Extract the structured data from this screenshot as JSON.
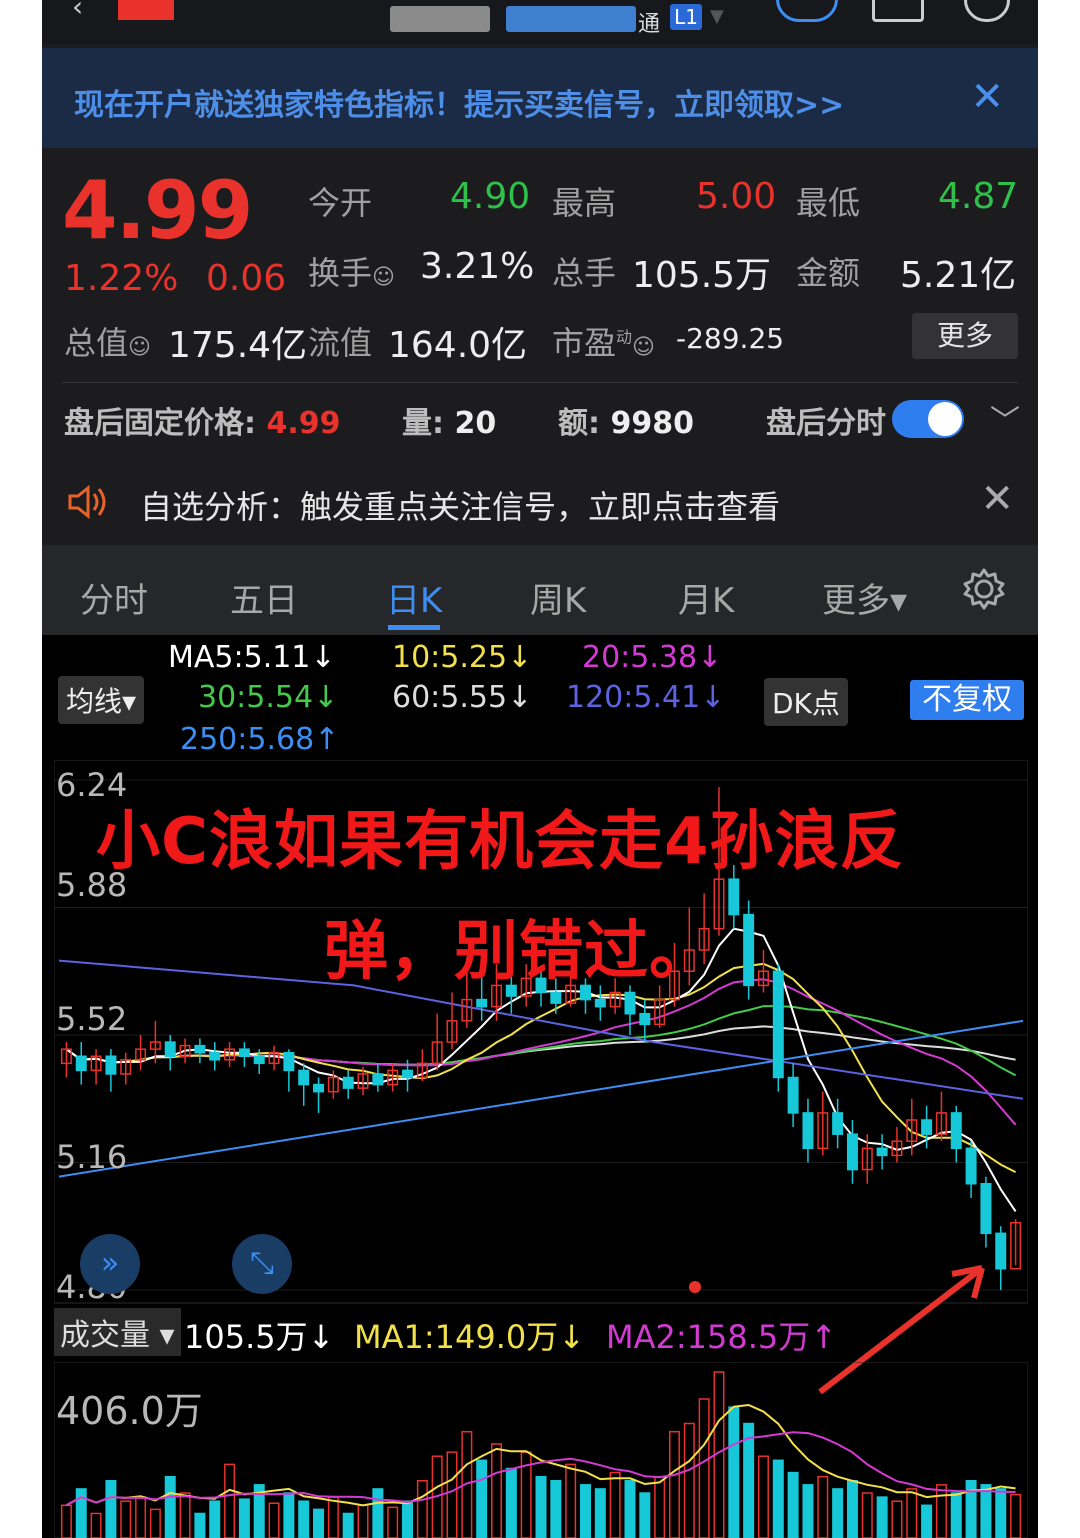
{
  "header": {
    "tag_tong": "通",
    "tag_level": "L1"
  },
  "banner": {
    "text": "现在开户就送独家特色指标！提示买卖信号，立即领取>>",
    "close": "✕"
  },
  "quote": {
    "price": "4.99",
    "change_pct": "1.22%",
    "change_abs": "0.06",
    "open_label": "今开",
    "open": "4.90",
    "high_label": "最高",
    "high": "5.00",
    "low_label": "最低",
    "low": "4.87",
    "turnover_label": "换手",
    "turnover": "3.21%",
    "volume_label": "总手",
    "volume": "105.5万",
    "amount_label": "金额",
    "amount": "5.21亿",
    "mcap_label": "总值",
    "mcap": "175.4亿",
    "float_label": "流值",
    "float": "164.0亿",
    "pe_label": "市盈",
    "pe_sup": "动",
    "pe": "-289.25",
    "more": "更多"
  },
  "after_hours": {
    "price_label": "盘后固定价格: ",
    "price": "4.99",
    "vol_label": "量: ",
    "vol": "20",
    "amt_label": "额: ",
    "amt": "9980",
    "toggle_label": "盘后分时",
    "toggle_on": true
  },
  "notice": {
    "text": "自选分析：触发重点关注信号，立即点击查看",
    "close": "✕"
  },
  "tabs": [
    {
      "label": "分时"
    },
    {
      "label": "五日"
    },
    {
      "label": "日K",
      "active": true
    },
    {
      "label": "周K"
    },
    {
      "label": "月K"
    },
    {
      "label": "更多▾"
    }
  ],
  "ma_lines": {
    "selector": "均线▾",
    "ma5": "MA5:5.11↓",
    "ma10": "10:5.25↓",
    "ma20": "20:5.38↓",
    "ma30": "30:5.54↓",
    "ma60": "60:5.55↓",
    "ma120": "120:5.41↓",
    "ma250": "250:5.68↑",
    "dk": "DK点",
    "adj": "不复权"
  },
  "colors": {
    "up": "#e8322b",
    "down": "#16c8d8",
    "accent": "#3d8ef2",
    "ma5": "#ffffff",
    "ma10": "#f2e04a",
    "ma20": "#d33ad3",
    "ma30": "#45c94a",
    "ma60": "#dcdcdc",
    "ma120": "#5c62e0",
    "ma250": "#3d8ef2"
  },
  "overlay_text": {
    "line1": "小C浪如果有机会走4孙浪反",
    "line2": "弹，别错过。"
  },
  "volume": {
    "selector": "成交量 ▾",
    "value": "105.5万↓",
    "ma1": "MA1:149.0万↓",
    "ma2": "MA2:158.5万↑",
    "max_label": "406.0万"
  },
  "chart_data": {
    "type": "candlestick",
    "y_ticks": [
      "6.24",
      "5.88",
      "5.52",
      "5.16",
      "4.80"
    ],
    "ylim": [
      4.8,
      6.24
    ],
    "candles": [
      [
        5.44,
        5.48,
        5.4,
        5.5
      ],
      [
        5.46,
        5.42,
        5.38,
        5.5
      ],
      [
        5.42,
        5.46,
        5.38,
        5.48
      ],
      [
        5.46,
        5.41,
        5.36,
        5.48
      ],
      [
        5.41,
        5.45,
        5.38,
        5.47
      ],
      [
        5.45,
        5.48,
        5.42,
        5.52
      ],
      [
        5.48,
        5.5,
        5.44,
        5.56
      ],
      [
        5.5,
        5.46,
        5.42,
        5.52
      ],
      [
        5.46,
        5.49,
        5.44,
        5.51
      ],
      [
        5.49,
        5.47,
        5.44,
        5.51
      ],
      [
        5.47,
        5.45,
        5.42,
        5.5
      ],
      [
        5.45,
        5.48,
        5.43,
        5.5
      ],
      [
        5.48,
        5.46,
        5.43,
        5.5
      ],
      [
        5.46,
        5.44,
        5.41,
        5.48
      ],
      [
        5.44,
        5.47,
        5.42,
        5.49
      ],
      [
        5.47,
        5.42,
        5.36,
        5.48
      ],
      [
        5.42,
        5.38,
        5.32,
        5.44
      ],
      [
        5.38,
        5.36,
        5.3,
        5.4
      ],
      [
        5.36,
        5.4,
        5.34,
        5.42
      ],
      [
        5.4,
        5.37,
        5.34,
        5.42
      ],
      [
        5.37,
        5.41,
        5.35,
        5.43
      ],
      [
        5.41,
        5.38,
        5.36,
        5.44
      ],
      [
        5.38,
        5.42,
        5.36,
        5.44
      ],
      [
        5.42,
        5.4,
        5.36,
        5.45
      ],
      [
        5.4,
        5.44,
        5.39,
        5.48
      ],
      [
        5.44,
        5.5,
        5.42,
        5.58
      ],
      [
        5.5,
        5.56,
        5.48,
        5.64
      ],
      [
        5.56,
        5.62,
        5.54,
        5.74
      ],
      [
        5.62,
        5.6,
        5.56,
        5.7
      ],
      [
        5.6,
        5.66,
        5.56,
        5.72
      ],
      [
        5.66,
        5.63,
        5.58,
        5.7
      ],
      [
        5.63,
        5.68,
        5.6,
        5.72
      ],
      [
        5.68,
        5.64,
        5.6,
        5.7
      ],
      [
        5.64,
        5.61,
        5.58,
        5.68
      ],
      [
        5.61,
        5.66,
        5.6,
        5.7
      ],
      [
        5.66,
        5.62,
        5.58,
        5.68
      ],
      [
        5.62,
        5.6,
        5.56,
        5.66
      ],
      [
        5.6,
        5.64,
        5.58,
        5.68
      ],
      [
        5.64,
        5.58,
        5.52,
        5.66
      ],
      [
        5.58,
        5.55,
        5.5,
        5.62
      ],
      [
        5.55,
        5.62,
        5.54,
        5.66
      ],
      [
        5.62,
        5.7,
        5.6,
        5.78
      ],
      [
        5.7,
        5.76,
        5.66,
        5.88
      ],
      [
        5.76,
        5.82,
        5.72,
        5.92
      ],
      [
        5.82,
        5.96,
        5.8,
        6.22
      ],
      [
        5.96,
        5.86,
        5.82,
        6.0
      ],
      [
        5.86,
        5.66,
        5.62,
        5.9
      ],
      [
        5.66,
        5.7,
        5.64,
        5.76
      ],
      [
        5.7,
        5.4,
        5.36,
        5.72
      ],
      [
        5.4,
        5.3,
        5.26,
        5.44
      ],
      [
        5.3,
        5.2,
        5.16,
        5.34
      ],
      [
        5.2,
        5.3,
        5.18,
        5.36
      ],
      [
        5.3,
        5.24,
        5.2,
        5.34
      ],
      [
        5.24,
        5.14,
        5.1,
        5.28
      ],
      [
        5.14,
        5.2,
        5.1,
        5.24
      ],
      [
        5.2,
        5.18,
        5.14,
        5.24
      ],
      [
        5.18,
        5.22,
        5.16,
        5.26
      ],
      [
        5.22,
        5.28,
        5.18,
        5.34
      ],
      [
        5.28,
        5.24,
        5.2,
        5.32
      ],
      [
        5.24,
        5.3,
        5.22,
        5.36
      ],
      [
        5.3,
        5.2,
        5.16,
        5.32
      ],
      [
        5.2,
        5.1,
        5.06,
        5.22
      ],
      [
        5.1,
        4.96,
        4.92,
        5.12
      ],
      [
        4.96,
        4.86,
        4.8,
        4.98
      ],
      [
        4.86,
        4.99,
        4.87,
        5.0
      ]
    ],
    "volume_max": 406.0,
    "volumes": [
      80,
      120,
      60,
      140,
      90,
      100,
      70,
      150,
      110,
      60,
      90,
      180,
      95,
      130,
      85,
      110,
      90,
      70,
      100,
      60,
      80,
      120,
      75,
      90,
      140,
      200,
      210,
      260,
      190,
      230,
      170,
      210,
      150,
      140,
      180,
      130,
      120,
      160,
      140,
      110,
      150,
      260,
      280,
      340,
      406,
      320,
      280,
      200,
      190,
      160,
      130,
      150,
      120,
      140,
      110,
      100,
      90,
      120,
      80,
      130,
      110,
      140,
      130,
      120,
      106
    ]
  }
}
